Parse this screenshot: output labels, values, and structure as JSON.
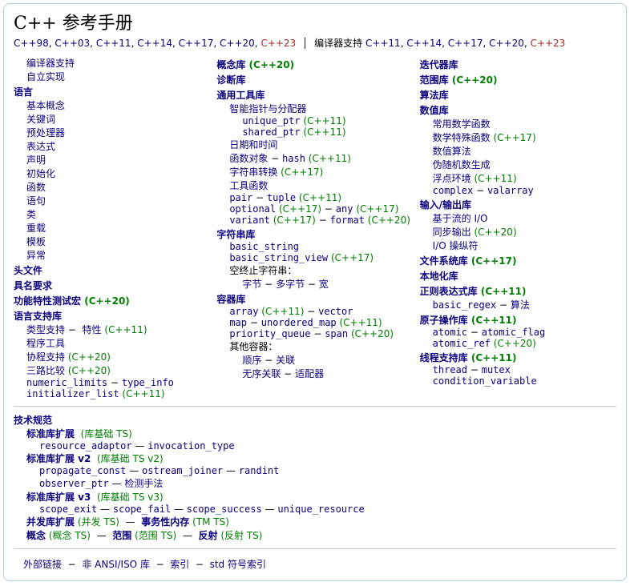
{
  "title": "C++ 参考手册",
  "rev": {
    "r98": "C++98",
    "r03": "C++03",
    "r11": "C++11",
    "r14": "C++14",
    "r17": "C++17",
    "r20": "C++20",
    "r23": "C++23"
  },
  "compiler_support_label": "编译器支持",
  "top_compiler": {
    "r11": "C++11",
    "r14": "C++14",
    "r17": "C++17",
    "r20": "C++20",
    "r23": "C++23"
  },
  "m11": "(C++11)",
  "m14": "(C++14)",
  "m17": "(C++17)",
  "m20": "(C++20)",
  "dash": "−",
  "c1": {
    "compiler": "编译器支持",
    "freestanding": "自立实现",
    "lang": "语言",
    "basic": "基本概念",
    "keywords": "关键词",
    "preproc": "预处理器",
    "expr": "表达式",
    "decl": "声明",
    "init": "初始化",
    "func": "函数",
    "stmt": "语句",
    "classes": "类",
    "overload": "重载",
    "tmpl": "模板",
    "except": "异常",
    "headers": "头文件",
    "named_req": "具名要求",
    "feature_test": "功能特性测试宏",
    "lang_support": "语言支持库",
    "type_support": "类型支持",
    "traits": "特性",
    "program": "程序工具",
    "coroutine": "协程支持",
    "compare": "三路比较",
    "numeric_limits": "numeric_limits",
    "type_info": "type_info",
    "initializer_list": "initializer_list"
  },
  "c2": {
    "concepts": "概念库",
    "diag": "诊断库",
    "util": "通用工具库",
    "smart": "智能指针与分配器",
    "unique_ptr": "unique_ptr",
    "shared_ptr": "shared_ptr",
    "datetime": "日期和时间",
    "funcobj": "函数对象",
    "hash": "hash",
    "strconv": "字符串转换",
    "utilfn": "工具函数",
    "pair": "pair",
    "tuple": "tuple",
    "optional": "optional",
    "any": "any",
    "variant": "variant",
    "format": "format",
    "strings": "字符串库",
    "basic_string": "basic_string",
    "basic_string_view": "basic_string_view",
    "nullterm": "空终止字符串：",
    "byte": "字节",
    "multibyte": "多字节",
    "wide": "宽",
    "containers": "容器库",
    "array": "array",
    "vector": "vector",
    "map": "map",
    "unordered_map": "unordered_map",
    "priority_queue": "priority_queue",
    "span": "span",
    "other": "其他容器：",
    "seq": "顺序",
    "assoc": "关联",
    "unord": "无序关联",
    "adapt": "适配器"
  },
  "c3": {
    "iter": "迭代器库",
    "ranges": "范围库",
    "algo": "算法库",
    "numerics": "数值库",
    "common_math": "常用数学函数",
    "special_math": "数学特殊函数",
    "numeric_algo": "数值算法",
    "pseudo": "伪随机数生成",
    "fenv": "浮点环境",
    "complex": "complex",
    "valarray": "valarray",
    "io": "输入/输出库",
    "stream_io": "基于流的 I/O",
    "sync_out": "同步输出",
    "iomanip": "I/O 操纵符",
    "fs": "文件系统库",
    "locale": "本地化库",
    "regex": "正则表达式库",
    "basic_regex": "basic_regex",
    "regex_algo": "算法",
    "atomic_lib": "原子操作库",
    "atomic": "atomic",
    "atomic_flag": "atomic_flag",
    "atomic_ref": "atomic_ref",
    "thread_lib": "线程支持库",
    "thread": "thread",
    "mutex": "mutex",
    "cond_var": "condition_variable"
  },
  "ts": {
    "tech": "技术规范",
    "libext": "标准库扩展",
    "libext_tag": "(库基础 TS)",
    "resource_adaptor": "resource_adaptor",
    "invocation_type": "invocation_type",
    "libext2": "标准库扩展 v2",
    "libext2_tag": "(库基础 TS v2)",
    "propagate_const": "propagate_const",
    "ostream_joiner": "ostream_joiner",
    "randint": "randint",
    "observer_ptr": "observer_ptr",
    "detect": "检测手法",
    "libext3": "标准库扩展 v3",
    "libext3_tag": "(库基础 TS v3)",
    "scope_exit": "scope_exit",
    "scope_fail": "scope_fail",
    "scope_success": "scope_success",
    "unique_resource": "unique_resource",
    "concurr": "并发库扩展",
    "concurr_tag": "(并发 TS)",
    "tm": "事务性内存",
    "tm_tag": "(TM TS)",
    "concepts": "概念",
    "concepts_tag": "(概念 TS)",
    "ranges": "范围",
    "ranges_tag": "(范围 TS)",
    "reflect": "反射",
    "reflect_tag": "(反射 TS)"
  },
  "footer": {
    "ext_links": "外部链接",
    "non_ansi": "非 ANSI/ISO 库",
    "index": "索引",
    "std_index": "std 符号索引"
  }
}
